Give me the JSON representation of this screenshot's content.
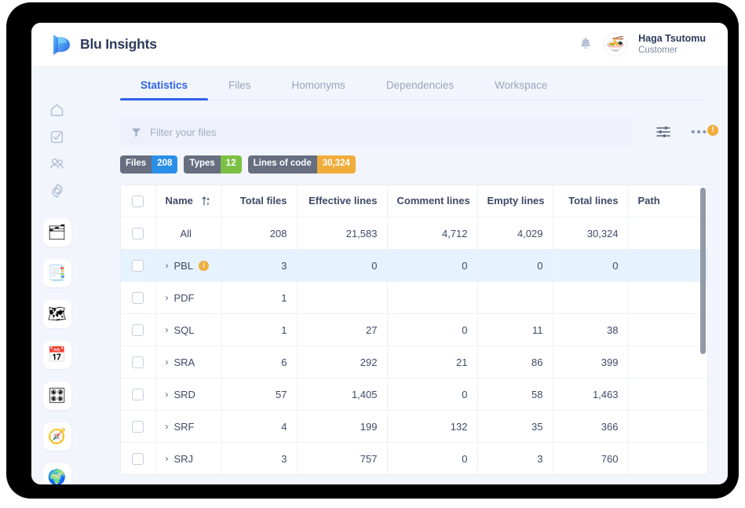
{
  "header": {
    "brand": "Blu Insights",
    "logo_icon": "blu-insights-logo",
    "bell_icon": "notification-bell-icon",
    "avatar_icon": "ramen-bowl-avatar",
    "avatar_glyph": "🍜",
    "user_name": "Haga Tsutomu",
    "user_role": "Customer"
  },
  "sidebar": {
    "plain_items": [
      {
        "name": "home",
        "icon": "home-icon"
      },
      {
        "name": "tasks",
        "icon": "checkbox-check-icon"
      },
      {
        "name": "users",
        "icon": "users-icon"
      },
      {
        "name": "settings",
        "icon": "gear-icon"
      }
    ],
    "card_items": [
      {
        "name": "files",
        "icon": "file-box-icon",
        "glyph": "🗂"
      },
      {
        "name": "documents",
        "icon": "documents-icon",
        "glyph": "📑"
      },
      {
        "name": "analysis",
        "icon": "analysis-icon",
        "glyph": "🗺"
      },
      {
        "name": "planning",
        "icon": "calendar-icon",
        "glyph": "📅"
      },
      {
        "name": "dashboard",
        "icon": "dashboard-icon",
        "glyph": "🎛"
      },
      {
        "name": "compass",
        "icon": "compass-icon",
        "glyph": "🧭"
      },
      {
        "name": "globe",
        "icon": "globe-icon",
        "glyph": "🌍"
      }
    ]
  },
  "tabs": [
    {
      "label": "Statistics",
      "active": true
    },
    {
      "label": "Files",
      "active": false
    },
    {
      "label": "Homonyms",
      "active": false
    },
    {
      "label": "Dependencies",
      "active": false
    },
    {
      "label": "Workspace",
      "active": false
    }
  ],
  "filter": {
    "placeholder": "Filter your files",
    "value": "",
    "icon": "filter-funnel-icon"
  },
  "toolbar": {
    "settings_icon": "sliders-icon",
    "more_icon": "more-dots-icon",
    "more_label": "•••",
    "more_badge": "!"
  },
  "stat_badges": [
    {
      "label": "Files",
      "value": "208",
      "color": "#2b8fe8"
    },
    {
      "label": "Types",
      "value": "12",
      "color": "#7cc043"
    },
    {
      "label": "Lines of code",
      "value": "30,324",
      "color": "#f0ad3c"
    }
  ],
  "table": {
    "sort_icon": "sort-az-ascending-icon",
    "columns": [
      "Name",
      "Total files",
      "Effective lines",
      "Comment lines",
      "Empty lines",
      "Total lines",
      "Path"
    ],
    "rows": [
      {
        "name": "All",
        "expandable": false,
        "warn": false,
        "highlight": false,
        "total_files": "208",
        "effective": "21,583",
        "comment": "4,712",
        "empty": "4,029",
        "total": "30,324",
        "path": ""
      },
      {
        "name": "PBL",
        "expandable": true,
        "warn": true,
        "highlight": true,
        "total_files": "3",
        "effective": "0",
        "comment": "0",
        "empty": "0",
        "total": "0",
        "path": ""
      },
      {
        "name": "PDF",
        "expandable": true,
        "warn": false,
        "highlight": false,
        "total_files": "1",
        "effective": "",
        "comment": "",
        "empty": "",
        "total": "",
        "path": ""
      },
      {
        "name": "SQL",
        "expandable": true,
        "warn": false,
        "highlight": false,
        "total_files": "1",
        "effective": "27",
        "comment": "0",
        "empty": "11",
        "total": "38",
        "path": ""
      },
      {
        "name": "SRA",
        "expandable": true,
        "warn": false,
        "highlight": false,
        "total_files": "6",
        "effective": "292",
        "comment": "21",
        "empty": "86",
        "total": "399",
        "path": ""
      },
      {
        "name": "SRD",
        "expandable": true,
        "warn": false,
        "highlight": false,
        "total_files": "57",
        "effective": "1,405",
        "comment": "0",
        "empty": "58",
        "total": "1,463",
        "path": ""
      },
      {
        "name": "SRF",
        "expandable": true,
        "warn": false,
        "highlight": false,
        "total_files": "4",
        "effective": "199",
        "comment": "132",
        "empty": "35",
        "total": "366",
        "path": ""
      },
      {
        "name": "SRJ",
        "expandable": true,
        "warn": false,
        "highlight": false,
        "total_files": "3",
        "effective": "757",
        "comment": "0",
        "empty": "3",
        "total": "760",
        "path": ""
      }
    ]
  },
  "colors": {
    "accent": "#2f63e8",
    "warning": "#f0ad3c",
    "highlight_row": "#e6f2fd",
    "page_bg": "#f2f5fc"
  }
}
